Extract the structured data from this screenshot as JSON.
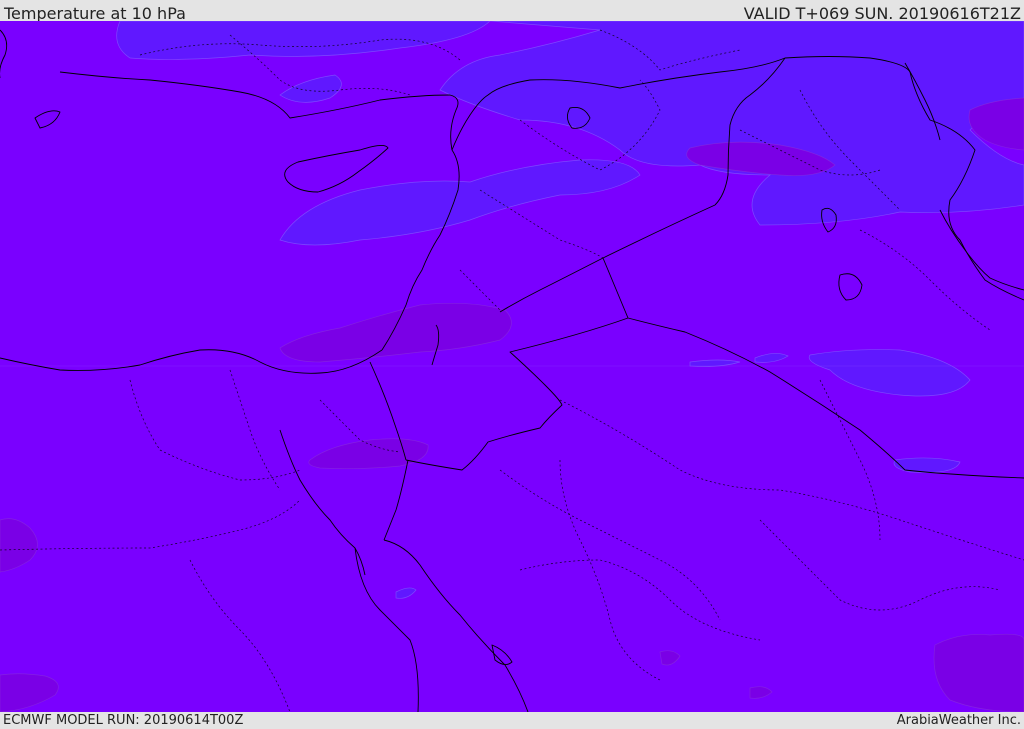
{
  "header": {
    "title": "Temperature at 10 hPa",
    "valid": "VALID T+069 SUN. 20190616T21Z"
  },
  "footer": {
    "model_run": "ECMWF MODEL RUN: 20190614T00Z",
    "credit": "ArabiaWeather Inc."
  },
  "colors": {
    "base_field": "#7a00ff",
    "cold_field": "#6018ff",
    "warm_field": "#7a00e6",
    "borders": "#000000"
  }
}
